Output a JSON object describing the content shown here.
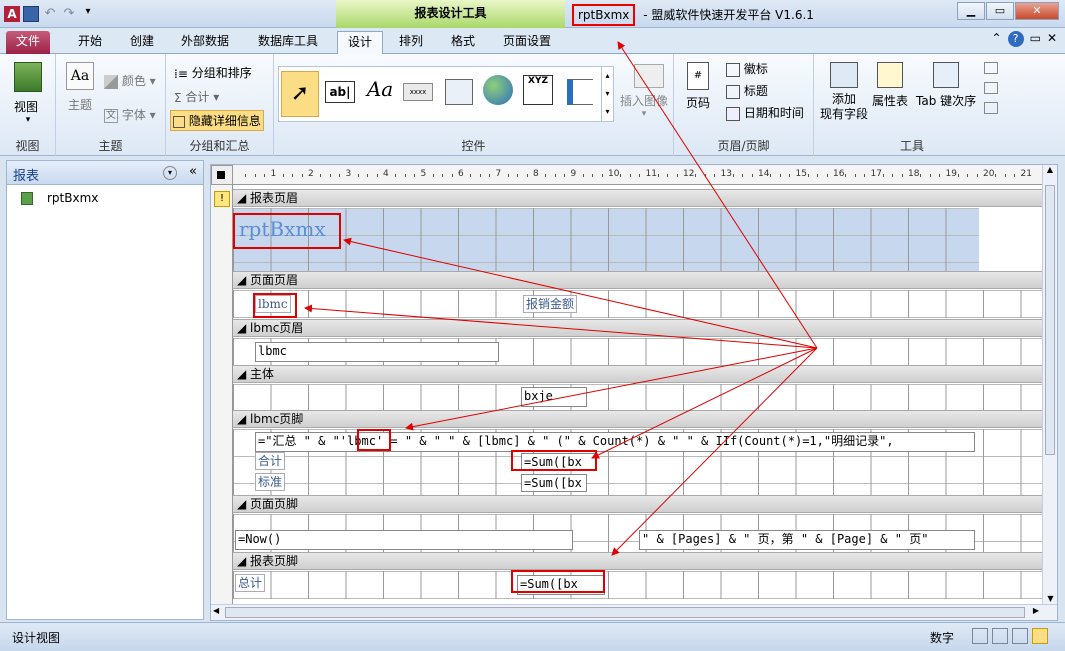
{
  "title_bar": {
    "app_letter": "A",
    "context_tools": "报表设计工具",
    "doc_name": "rptBxmx",
    "separator": " - ",
    "app_title": "盟威软件快速开发平台 V1.6.1",
    "window_buttons": [
      "minimize-icon",
      "restore-icon",
      "close-icon"
    ]
  },
  "tabs": [
    "文件",
    "开始",
    "创建",
    "外部数据",
    "数据库工具",
    "设计",
    "排列",
    "格式",
    "页面设置"
  ],
  "active_tab": "设计",
  "ribbon": {
    "groups": [
      {
        "label": "视图",
        "items": [
          "视图"
        ]
      },
      {
        "label": "主题",
        "items": [
          "主题",
          "颜色",
          "字体"
        ]
      },
      {
        "label": "分组和汇总",
        "items": [
          "分组和排序",
          "合计",
          "隐藏详细信息"
        ]
      },
      {
        "label": "控件",
        "items": [
          "插入图像"
        ]
      },
      {
        "label": "页眉/页脚",
        "items": [
          "页码",
          "徽标",
          "标题",
          "日期和时间"
        ]
      },
      {
        "label": "工具",
        "items": [
          "添加\n现有字段",
          "属性表",
          "Tab 键次序"
        ]
      }
    ],
    "gallery_texts": [
      "ab|",
      "Aa",
      "xxxx",
      "XYZ"
    ]
  },
  "nav": {
    "header": "报表",
    "items": [
      "rptBxmx"
    ]
  },
  "design": {
    "ruler_numbers": [
      "1",
      "2",
      "3",
      "4",
      "5",
      "6",
      "7",
      "8",
      "9",
      "10",
      "11",
      "12",
      "13",
      "14",
      "15",
      "16",
      "17",
      "18",
      "19",
      "20",
      "21"
    ],
    "bands": {
      "report_header": "报表页眉",
      "page_header": "页面页眉",
      "group_header": "lbmc页眉",
      "detail": "主体",
      "group_footer": "lbmc页脚",
      "page_footer": "页面页脚",
      "report_footer": "报表页脚"
    },
    "controls": {
      "report_title": "rptBxmx",
      "ph_lbmc": "lbmc",
      "ph_amount": "报销金额",
      "gh_lbmc": "lbmc",
      "detail_bxje": "bxje",
      "gf_expr_a": "=\"汇总 \" & \"'",
      "gf_expr_b": "lbmc",
      "gf_expr_c": "' = \" & \" \" & [lbmc] & \" (\" & Count(*) & \" \" & IIf(Count(*)=1,\"明细记录\",",
      "gf_heji": "合计",
      "gf_sum1": "=Sum([bx",
      "gf_biaozhun": "标准",
      "gf_sum2": "=Sum([bx",
      "pf_now": "=Now()",
      "pf_pages": "\" & [Pages] & \" 页，第 \" & [Page] & \" 页\"",
      "rf_total": "总计",
      "rf_sum": "=Sum([bx"
    }
  },
  "status": {
    "left": "设计视图",
    "right": "数字"
  },
  "colors": {
    "annotation": "#e00000",
    "file_tab": "#b13a5f",
    "context_tab": "#a9d86a"
  }
}
